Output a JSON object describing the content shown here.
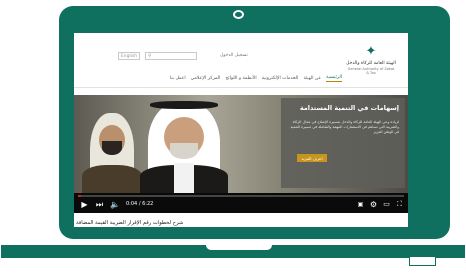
{
  "header": {
    "lang_button": "English",
    "search_placeholder": "",
    "login_link": "تسجيل الدخول",
    "logo_arabic": "الهيئة العامة للزكاة والدخل",
    "logo_english": "General Authority of Zakat & Tax"
  },
  "nav": {
    "items": [
      "الرئيسية",
      "عن الهيئة",
      "الخدمات الإلكترونية",
      "الأنظمة و اللوائح",
      "المركز الإعلامي",
      "اعمل بنا"
    ]
  },
  "hero": {
    "title": "إسهامات في التنمية المستدامة",
    "text": "لزيادة وعي الهيئة العامة للزكاة والدخل بمسيرة الإصلاح في مجال الزكاة والضريبة التي تساهم في الاستثمارات المهمة والشاملة في مسيرة التنمية في الوطن العزيز",
    "button": "اعرف المزيد"
  },
  "video": {
    "time_current": "0:04",
    "time_total": "6:22",
    "time_display": "0:04 / 6:22",
    "progress": 0.0105,
    "caption": "شرح لخطوات رقم الإقرار الضريبة القيمة المضافة"
  }
}
